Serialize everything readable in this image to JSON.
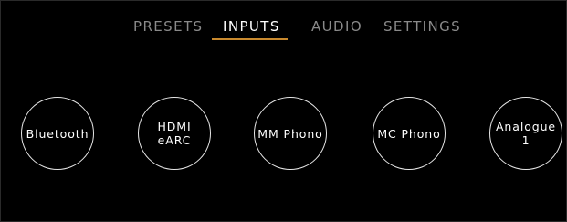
{
  "nav": {
    "tabs": [
      {
        "label": "PRESETS"
      },
      {
        "label": "INPUTS"
      },
      {
        "label": "AUDIO"
      },
      {
        "label": "SETTINGS"
      }
    ],
    "active_tab": "INPUTS"
  },
  "inputs": [
    {
      "label": "Bluetooth"
    },
    {
      "label": "HDMI\neARC"
    },
    {
      "label": "MM Phono"
    },
    {
      "label": "MC Phono"
    },
    {
      "label": "Analogue 1"
    }
  ],
  "colors": {
    "background": "#000000",
    "text": "#ffffff",
    "inactive_text": "#8a8a8a",
    "accent_underline": "#c8892e",
    "circle_border": "#e6e6e6"
  }
}
